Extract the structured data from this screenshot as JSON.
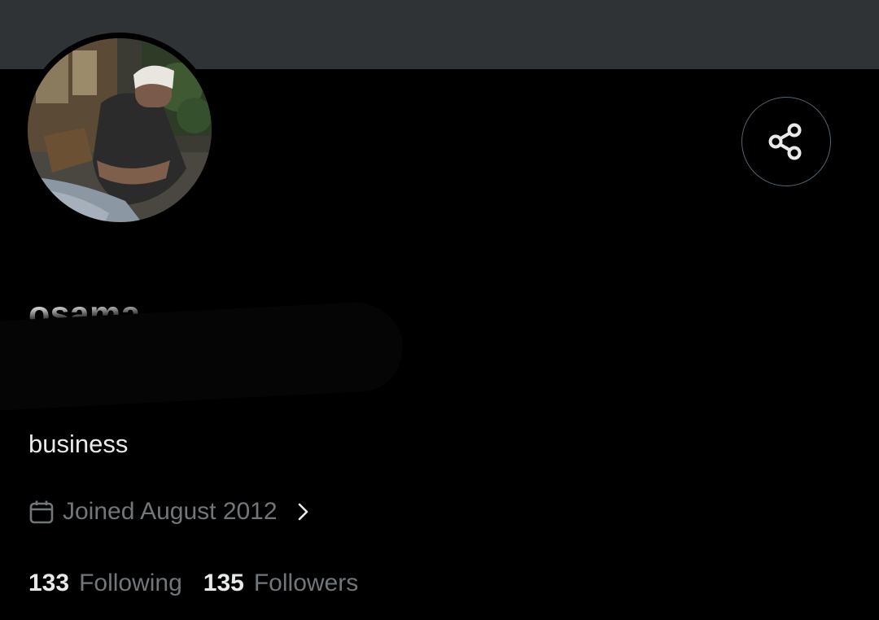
{
  "profile": {
    "display_name": "osama",
    "bio": "business",
    "joined": "Joined August 2012",
    "avatar_icon": "profile-photo",
    "share_icon": "share-icon"
  },
  "stats": {
    "following_count": "133",
    "following_label": "Following",
    "followers_count": "135",
    "followers_label": "Followers"
  },
  "colors": {
    "background": "#000000",
    "banner": "#2f3336",
    "primary_text": "#e7e9ea",
    "secondary_text": "#71767b",
    "border": "#536471"
  }
}
